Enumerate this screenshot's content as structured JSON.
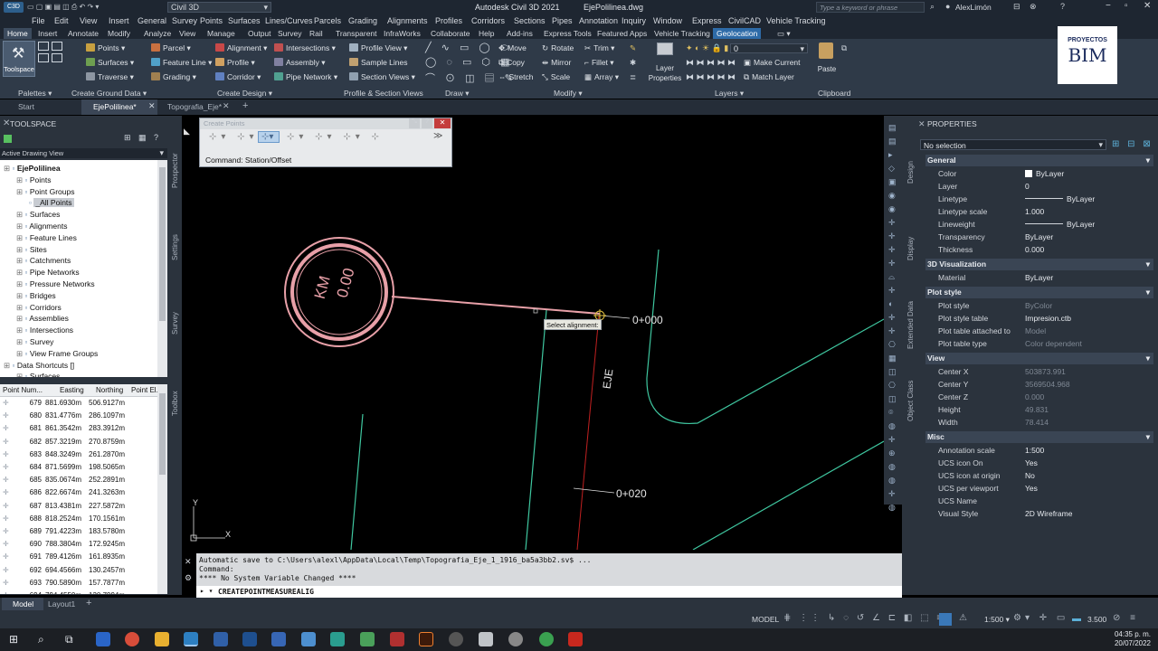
{
  "title_bar": {
    "app_title": "Autodesk Civil 3D 2021",
    "file_name": "EjePolilinea.dwg",
    "workspace": "Civil 3D",
    "search_placeholder": "Type a keyword or phrase",
    "user": "AlexLimón"
  },
  "menu": [
    "File",
    "Edit",
    "View",
    "Insert",
    "General",
    "Survey",
    "Points",
    "Surfaces",
    "Lines/Curves",
    "Parcels",
    "Grading",
    "Alignments",
    "Profiles",
    "Corridors",
    "Sections",
    "Pipes",
    "Annotation",
    "Inquiry",
    "Window",
    "Express",
    "CivilCAD",
    "Vehicle Tracking"
  ],
  "ribbon_tabs": [
    "Home",
    "Insert",
    "Annotate",
    "Modify",
    "Analyze",
    "View",
    "Manage",
    "Output",
    "Survey",
    "Rail",
    "Transparent",
    "InfraWorks",
    "Collaborate",
    "Help",
    "Add-ins",
    "Express Tools",
    "Featured Apps",
    "Vehicle Tracking",
    "Geolocation"
  ],
  "ribbon": {
    "toolspace": "Toolspace",
    "palettes_group": "Palettes",
    "ground": [
      "Points",
      "Surfaces",
      "Traverse"
    ],
    "ground_group": "Create Ground Data",
    "design": [
      "Parcel",
      "Feature Line",
      "Grading",
      "Alignment",
      "Profile",
      "Corridor",
      "Intersections",
      "Assembly",
      "Pipe Network"
    ],
    "design_group": "Create Design",
    "profile": [
      "Profile View",
      "Sample Lines",
      "Section Views"
    ],
    "profile_group": "Profile & Section Views",
    "draw_group": "Draw",
    "modify": [
      "Move",
      "Rotate",
      "Trim",
      "Copy",
      "Mirror",
      "Fillet",
      "Stretch",
      "Scale",
      "Array"
    ],
    "modify_group": "Modify",
    "layer_properties": [
      "Layer",
      "Properties"
    ],
    "make_current": "Make Current",
    "match_layer": "Match Layer",
    "layer_value": "0",
    "layers_group": "Layers",
    "paste": "Paste",
    "clipboard_group": "Clipboard",
    "logo": [
      "PROYECTOS",
      "BIM"
    ]
  },
  "doc_tabs": [
    "Start",
    "EjePolilinea*",
    "Topografia_Eje*"
  ],
  "toolspace": {
    "title": "TOOLSPACE",
    "view_mode": "Active Drawing View",
    "side_tabs": [
      "Prospector",
      "Settings",
      "Survey",
      "Toolbox"
    ],
    "tree": [
      {
        "label": "EjePolilinea",
        "level": 0,
        "bold": true
      },
      {
        "label": "Points",
        "level": 1
      },
      {
        "label": "Point Groups",
        "level": 1
      },
      {
        "label": "_All Points",
        "level": 2,
        "selected": true
      },
      {
        "label": "Surfaces",
        "level": 1
      },
      {
        "label": "Alignments",
        "level": 1
      },
      {
        "label": "Feature Lines",
        "level": 1
      },
      {
        "label": "Sites",
        "level": 1
      },
      {
        "label": "Catchments",
        "level": 1
      },
      {
        "label": "Pipe Networks",
        "level": 1
      },
      {
        "label": "Pressure Networks",
        "level": 1
      },
      {
        "label": "Bridges",
        "level": 1
      },
      {
        "label": "Corridors",
        "level": 1
      },
      {
        "label": "Assemblies",
        "level": 1
      },
      {
        "label": "Intersections",
        "level": 1
      },
      {
        "label": "Survey",
        "level": 1
      },
      {
        "label": "View Frame Groups",
        "level": 1
      },
      {
        "label": "Data Shortcuts []",
        "level": 0
      },
      {
        "label": "Surfaces",
        "level": 1
      }
    ],
    "point_columns": [
      "Point Num...",
      "Easting",
      "Northing",
      "Point El..."
    ],
    "points": [
      [
        "679",
        "881.6930m",
        "506.9127m"
      ],
      [
        "680",
        "831.4776m",
        "286.1097m"
      ],
      [
        "681",
        "861.3542m",
        "283.3912m"
      ],
      [
        "682",
        "857.3219m",
        "270.8759m"
      ],
      [
        "683",
        "848.3249m",
        "261.2870m"
      ],
      [
        "684",
        "871.5699m",
        "198.5065m"
      ],
      [
        "685",
        "835.0674m",
        "252.2891m"
      ],
      [
        "686",
        "822.6674m",
        "241.3263m"
      ],
      [
        "687",
        "813.4381m",
        "227.5872m"
      ],
      [
        "688",
        "818.2524m",
        "170.1561m"
      ],
      [
        "689",
        "791.4223m",
        "183.5780m"
      ],
      [
        "690",
        "788.3804m",
        "172.9245m"
      ],
      [
        "691",
        "789.4126m",
        "161.8935m"
      ],
      [
        "692",
        "694.4566m",
        "130.2457m"
      ],
      [
        "693",
        "790.5890m",
        "157.7877m"
      ],
      [
        "694",
        "794.4550m",
        "130.7994m"
      ]
    ]
  },
  "create_points": {
    "title": "Create Points",
    "command": "Command: Station/Offset"
  },
  "canvas": {
    "km_top": "KM",
    "km_bottom": "0.00",
    "station_0": "0+000",
    "station_20": "0+020",
    "alignment_label": "EJE",
    "tooltip": "Select alignment:",
    "ucs_x": "X",
    "ucs_y": "Y"
  },
  "command_line": {
    "lines": [
      "Automatic save to C:\\Users\\alexl\\AppData\\Local\\Temp\\Topografia_Eje_1_1916_ba5a3bb2.sv$ ...",
      "Command:",
      "**** No System Variable Changed ****"
    ],
    "input": "CREATEPOINTMEASUREALIG"
  },
  "properties": {
    "title": "PROPERTIES",
    "selection": "No selection",
    "side_tabs": [
      "Design",
      "Display",
      "Extended Data",
      "Object Class"
    ],
    "sections": [
      {
        "name": "General",
        "rows": [
          {
            "k": "Color",
            "v": "ByLayer"
          },
          {
            "k": "Layer",
            "v": "0"
          },
          {
            "k": "Linetype",
            "v": "ByLayer"
          },
          {
            "k": "Linetype scale",
            "v": "1.000"
          },
          {
            "k": "Lineweight",
            "v": "ByLayer"
          },
          {
            "k": "Transparency",
            "v": "ByLayer"
          },
          {
            "k": "Thickness",
            "v": "0.000"
          }
        ]
      },
      {
        "name": "3D Visualization",
        "rows": [
          {
            "k": "Material",
            "v": "ByLayer"
          }
        ]
      },
      {
        "name": "Plot style",
        "rows": [
          {
            "k": "Plot style",
            "v": "ByColor",
            "dim": true
          },
          {
            "k": "Plot style table",
            "v": "Impresion.ctb"
          },
          {
            "k": "Plot table attached to",
            "v": "Model",
            "dim": true
          },
          {
            "k": "Plot table type",
            "v": "Color dependent",
            "dim": true
          }
        ]
      },
      {
        "name": "View",
        "rows": [
          {
            "k": "Center X",
            "v": "503873.991",
            "dim": true
          },
          {
            "k": "Center Y",
            "v": "3569504.968",
            "dim": true
          },
          {
            "k": "Center Z",
            "v": "0.000",
            "dim": true
          },
          {
            "k": "Height",
            "v": "49.831",
            "dim": true
          },
          {
            "k": "Width",
            "v": "78.414",
            "dim": true
          }
        ]
      },
      {
        "name": "Misc",
        "rows": [
          {
            "k": "Annotation scale",
            "v": "1:500"
          },
          {
            "k": "UCS icon On",
            "v": "Yes"
          },
          {
            "k": "UCS icon at origin",
            "v": "No"
          },
          {
            "k": "UCS per viewport",
            "v": "Yes"
          },
          {
            "k": "UCS Name",
            "v": ""
          },
          {
            "k": "Visual Style",
            "v": "2D Wireframe"
          }
        ]
      }
    ]
  },
  "status": {
    "model_tab": "Model",
    "layout_tab": "Layout1",
    "model_label": "MODEL",
    "scale": "1:500",
    "value": "3.500"
  },
  "taskbar": {
    "time": "04:35 p. m.",
    "date": "20/07/2022"
  },
  "colors": {
    "alignment_pink": "#e8a0a8",
    "line_green": "#3fc7a0",
    "axis_red": "#c02020",
    "ribbon_bg": "#2f3a48",
    "geolocation_tab": "#2e6ba8"
  }
}
